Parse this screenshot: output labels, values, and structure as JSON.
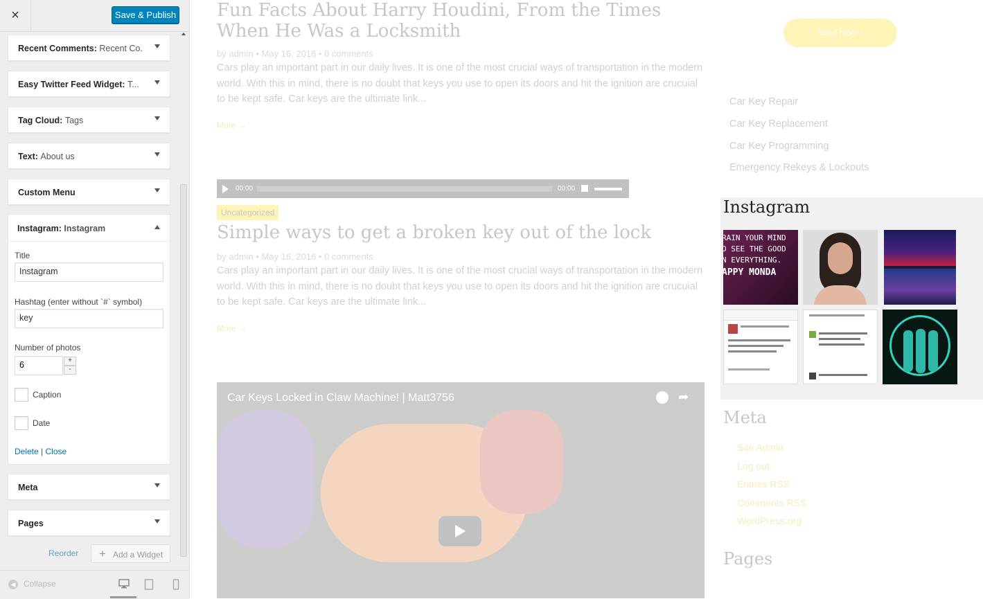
{
  "sidebar": {
    "close_icon": "×",
    "publish_label": "Save & Publish",
    "widgets": [
      {
        "title": "Recent Comments:",
        "sub": "Recent Co..."
      },
      {
        "title": "Easy Twitter Feed Widget:",
        "sub": "T..."
      },
      {
        "title": "Tag Cloud:",
        "sub": "Tags"
      },
      {
        "title": "Text:",
        "sub": "About us"
      },
      {
        "title": "Custom Menu",
        "sub": ""
      }
    ],
    "instagram": {
      "title": "Instagram:",
      "sub": "Instagram",
      "title_label": "Title",
      "title_value": "Instagram",
      "hashtag_label": "Hashtag (enter without `#` symbol)",
      "hashtag_value": "key",
      "photos_label": "Number of photos",
      "photos_value": "6",
      "caption_label": "Caption",
      "date_label": "Date",
      "delete_label": "Delete",
      "separator": "|",
      "close_label": "Close"
    },
    "bottom_widgets": [
      {
        "title": "Meta"
      },
      {
        "title": "Pages"
      }
    ],
    "reorder_label": "Reorder",
    "add_widget_label": "Add a Widget",
    "collapse_label": "Collapse"
  },
  "preview": {
    "post1": {
      "title": "Fun Facts About Harry Houdini, From the Times When He Was a Locksmith",
      "meta": "by admin  •  May 16, 2016  •  0 comments",
      "excerpt": "Cars play an important part in our daily lives. It is one of the most crucial ways of transportation in the modern world. With this in mind, there is no doubt that keys you use to open its doors and hit the ignition are crucuial to be kept safe. Car keys are the ultimate link...",
      "more": "More →"
    },
    "audio": {
      "time_start": "00:00",
      "time_end": "00:00"
    },
    "post2": {
      "category": "Uncategorized",
      "title": "Simple ways to get a broken key out of the lock",
      "meta": "by admin  •  May 16, 2016  •  0 comments",
      "excerpt": "Cars play an important part in our daily lives. It is one of the most crucial ways of transportation in the modern world. With this in mind, there is no doubt that keys you use to open its doors and hit the ignition are crucuial to be kept safe. Car keys are the ultimate link...",
      "more": "More →"
    },
    "video": {
      "title": "Car Keys Locked in Claw Machine! | Matt3756"
    },
    "right": {
      "read_more": "Read more  ›",
      "links": [
        "Car Key Repair",
        "Car Key Replacement",
        "Car Key Programming",
        "Emergency Rekeys & Lockouts"
      ],
      "instagram_title": "Instagram",
      "meta_title": "Meta",
      "meta_links": [
        "Site Admin",
        "Log out",
        "Entries RSS",
        "Comments RSS",
        "WordPress.org"
      ],
      "pages_title": "Pages"
    },
    "photo1_text": [
      "RAIN YOUR MIND",
      "O SEE THE GOOD",
      "N EVERYTHING.",
      "APPY MONDA"
    ],
    "colors": {
      "publish": "#0085ba",
      "accent": "#ffd600",
      "link": "#0073aa"
    }
  }
}
